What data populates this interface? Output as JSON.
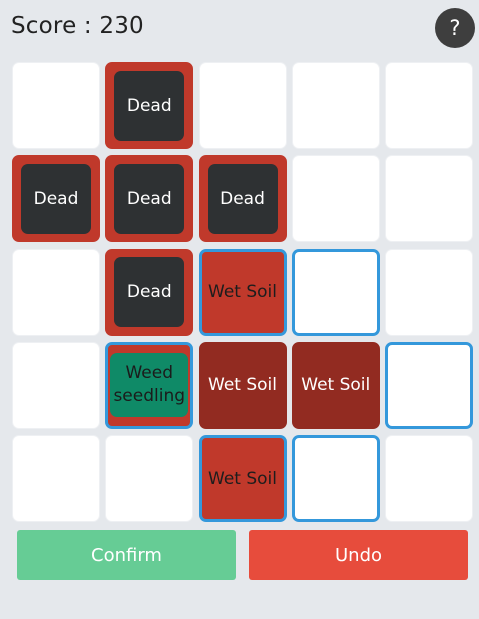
{
  "score_text": "Score : 230",
  "help_label": "?",
  "colors": {
    "background": "#e5e8ec",
    "empty_tile": "#ffffff",
    "soil": "#c0392b",
    "wet_soil": "#922b21",
    "dead_plant": "#2e3133",
    "weed": "#0f8a67",
    "selection_border": "#3498db",
    "confirm": "#66cc95",
    "undo": "#e74c3c"
  },
  "grid": [
    [
      {
        "type": "empty",
        "label": ""
      },
      {
        "type": "dead",
        "label": "Dead"
      },
      {
        "type": "empty",
        "label": ""
      },
      {
        "type": "empty",
        "label": ""
      },
      {
        "type": "empty",
        "label": ""
      }
    ],
    [
      {
        "type": "dead",
        "label": "Dead"
      },
      {
        "type": "dead",
        "label": "Dead"
      },
      {
        "type": "dead",
        "label": "Dead"
      },
      {
        "type": "empty",
        "label": ""
      },
      {
        "type": "empty",
        "label": ""
      }
    ],
    [
      {
        "type": "empty",
        "label": ""
      },
      {
        "type": "dead",
        "label": "Dead"
      },
      {
        "type": "soil-selected",
        "label": "Wet Soil"
      },
      {
        "type": "empty-selected",
        "label": ""
      },
      {
        "type": "empty",
        "label": ""
      }
    ],
    [
      {
        "type": "empty",
        "label": ""
      },
      {
        "type": "weed-selected",
        "label": "Weed seedling"
      },
      {
        "type": "wet",
        "label": "Wet Soil"
      },
      {
        "type": "wet",
        "label": "Wet Soil"
      },
      {
        "type": "empty-selected",
        "label": ""
      }
    ],
    [
      {
        "type": "empty",
        "label": ""
      },
      {
        "type": "empty",
        "label": ""
      },
      {
        "type": "soil-selected",
        "label": "Wet Soil"
      },
      {
        "type": "empty-selected",
        "label": ""
      },
      {
        "type": "empty",
        "label": ""
      }
    ]
  ],
  "buttons": {
    "confirm": "Confirm",
    "undo": "Undo"
  }
}
